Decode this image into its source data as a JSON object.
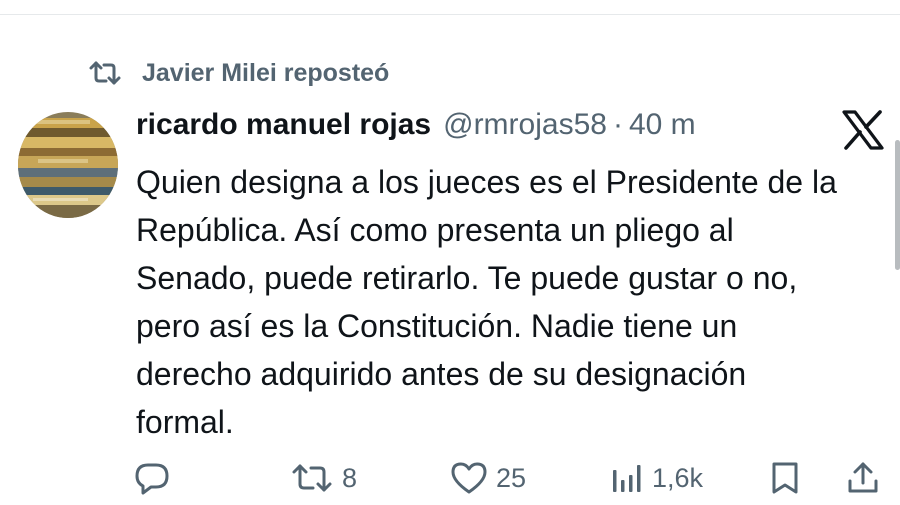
{
  "repost": {
    "icon": "retweet-icon",
    "text": "Javier Milei reposteó"
  },
  "tweet": {
    "author_name": "ricardo manuel rojas",
    "handle": "@rmrojas58",
    "separator": "·",
    "time_ago": "40 m",
    "lines": [
      "Quien designa a los jueces es el Presidente de la",
      "República. Así como presenta un pliego al",
      "Senado, puede retirarlo. Te puede gustar o no,",
      "pero así es la Constitución. Nadie tiene un",
      "derecho adquirido antes de su designación",
      "formal."
    ]
  },
  "actions": {
    "reply": {
      "icon": "reply-icon"
    },
    "retweet": {
      "icon": "retweet-icon",
      "count": "8"
    },
    "like": {
      "icon": "heart-icon",
      "count": "25"
    },
    "views": {
      "icon": "views-icon",
      "count": "1,6k"
    },
    "bookmark": {
      "icon": "bookmark-icon"
    },
    "share": {
      "icon": "share-icon"
    }
  },
  "colors": {
    "text_primary": "#0f1419",
    "text_secondary": "#536471",
    "divider": "#e6e9eb"
  }
}
